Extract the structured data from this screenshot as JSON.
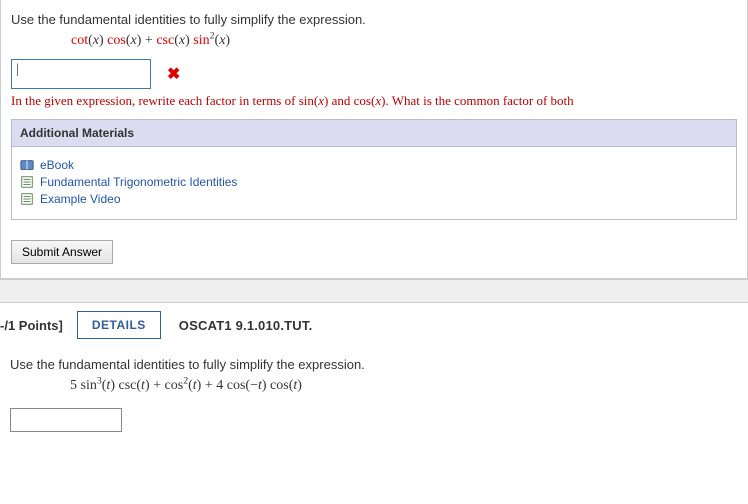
{
  "q1": {
    "prompt": "Use the fundamental identities to fully simplify the expression.",
    "expr_parts": {
      "cot": "cot",
      "cos": "cos",
      "plus": " + ",
      "csc": "csc",
      "sin": "sin",
      "var": "x",
      "exp": "2"
    },
    "answer_value": "|",
    "x_mark": "✖",
    "feedback_pre": "In the given expression, rewrite each factor in terms of  ",
    "feedback_sin": "sin",
    "feedback_and": "  and  ",
    "feedback_cos": "cos",
    "feedback_post": ".  What is the common factor of both"
  },
  "additional": {
    "heading": "Additional Materials",
    "items": [
      {
        "label": "eBook"
      },
      {
        "label": "Fundamental Trigonometric Identities"
      },
      {
        "label": "Example Video"
      }
    ]
  },
  "submit_label": "Submit Answer",
  "q2": {
    "points": "-/1 Points]",
    "details": "DETAILS",
    "ref": "OSCAT1 9.1.010.TUT.",
    "prompt": "Use the fundamental identities to fully simplify the expression.",
    "expr_parts": {
      "coef1": "5 ",
      "sin": "sin",
      "exp3": "3",
      "csc": "csc",
      "plus": " + ",
      "cos": "cos",
      "exp2": "2",
      "plus4": " + 4 ",
      "neg": "−",
      "var": "t"
    }
  }
}
